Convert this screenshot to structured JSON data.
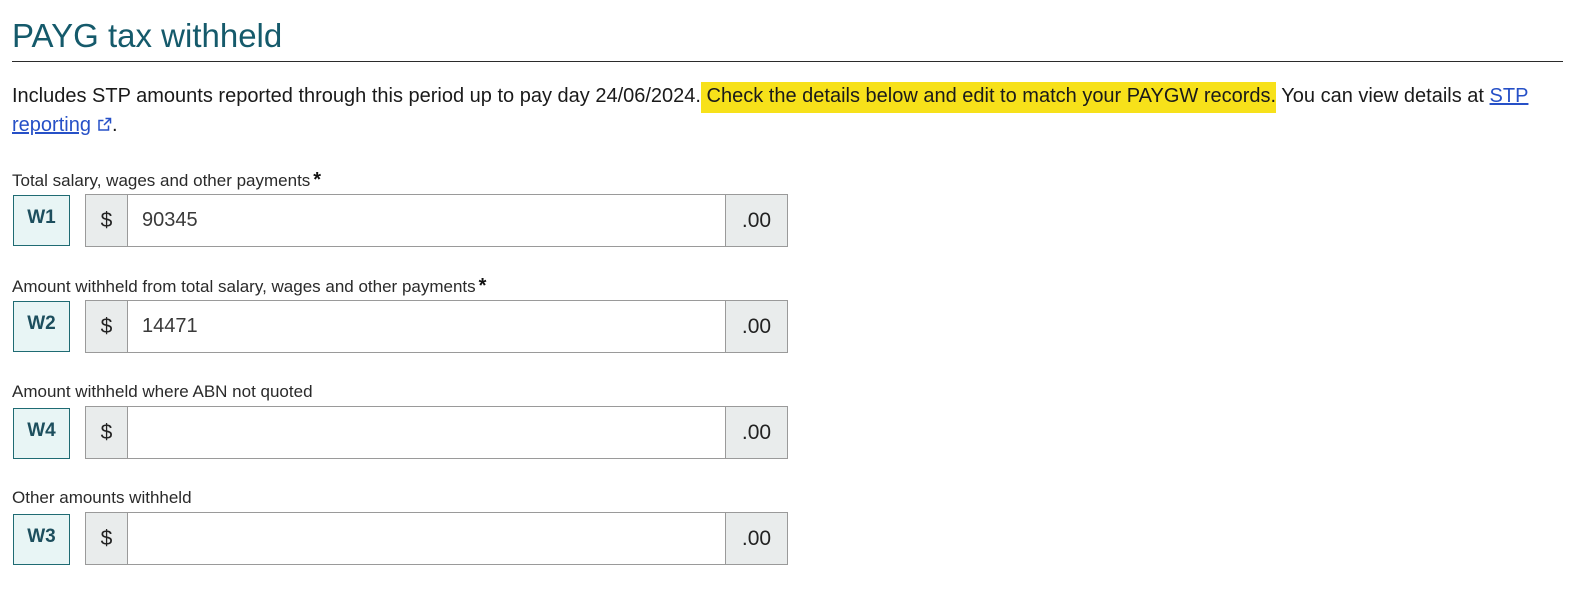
{
  "section": {
    "title": "PAYG tax withheld"
  },
  "intro": {
    "text_before": "Includes STP amounts reported through this period up to pay day 24/06/2024.",
    "highlighted": " Check the details below and edit to match your PAYGW records.",
    "text_after": " You can view details at ",
    "link_text": "STP reporting",
    "trailing": ".",
    "highlight_color": "#f7e11a",
    "link_icon": "external-link-icon"
  },
  "fields": [
    {
      "label": "Total salary, wages and other payments",
      "required_marker": "*",
      "code": "W1",
      "currency": "$",
      "value": "90345",
      "cents": ".00"
    },
    {
      "label": "Amount withheld from total salary, wages and other payments",
      "required_marker": "*",
      "code": "W2",
      "currency": "$",
      "value": "14471",
      "cents": ".00"
    },
    {
      "label": "Amount withheld where ABN not quoted",
      "code": "W4",
      "currency": "$",
      "value": "",
      "cents": ".00"
    },
    {
      "label": "Other amounts withheld",
      "code": "W3",
      "currency": "$",
      "value": "",
      "cents": ".00"
    }
  ],
  "colors": {
    "title": "#155a6b",
    "code_box_bg": "#e8f5f5",
    "code_box_border": "#1f6b73",
    "link": "#2650c7"
  }
}
